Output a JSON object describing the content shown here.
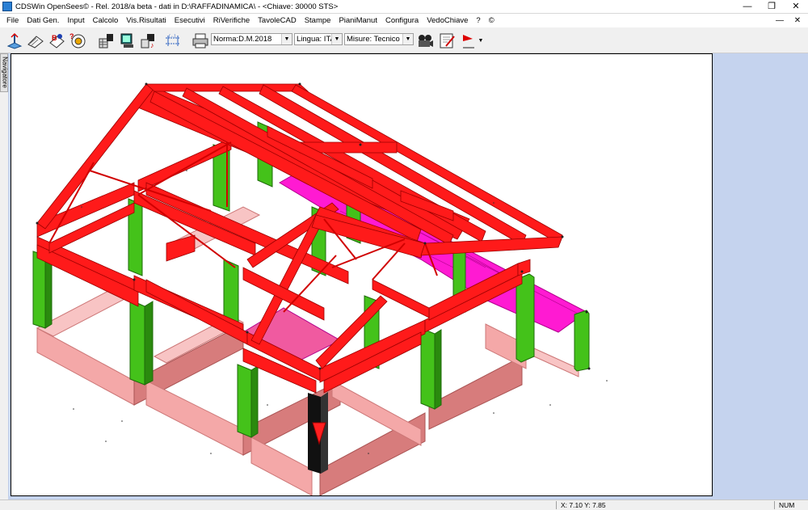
{
  "window": {
    "title": "CDSWin OpenSees© - Rel. 2018/a beta - dati in D:\\RAFFADINAMICA\\ - <Chiave: 30000 STS>",
    "minimize_glyph": "—",
    "maximize_glyph": "❐",
    "close_glyph": "✕"
  },
  "menu": {
    "items": [
      "File",
      "Dati Gen.",
      "Input",
      "Calcolo",
      "Vis.Risultati",
      "Esecutivi",
      "RiVerifiche",
      "TavoleCAD",
      "Stampe",
      "PianiManut",
      "Configura",
      "VedoChiave",
      "?",
      "©"
    ],
    "mdi_min": "—",
    "mdi_close": "✕"
  },
  "toolbar": {
    "icons": [
      "structure-icon",
      "input-icon",
      "bookmark-icon",
      "target-icon",
      "table-icon",
      "data-icon",
      "results-icon",
      "dimension-icon",
      "print-icon",
      "film-icon",
      "edit-icon",
      "warning-icon"
    ],
    "norma": "Norma:D.M.2018",
    "lingua": "Lingua: ITA",
    "misure": "Misure: Tecnico",
    "dropdown_glyph": "▼"
  },
  "navigator": {
    "label": "Navigatore"
  },
  "status": {
    "coords": "X:  7.10  Y:  7.85",
    "num": "NUM"
  },
  "colors": {
    "beam": "#ff1a1a",
    "beam_dark": "#b80000",
    "column": "#44c21a",
    "column_dark": "#2a8a0e",
    "foundation": "#f4a8a8",
    "foundation_dark": "#d77c7c",
    "slab": "#ff1ad2",
    "selected": "#111111",
    "workspace_bg": "#c5d3ee"
  }
}
